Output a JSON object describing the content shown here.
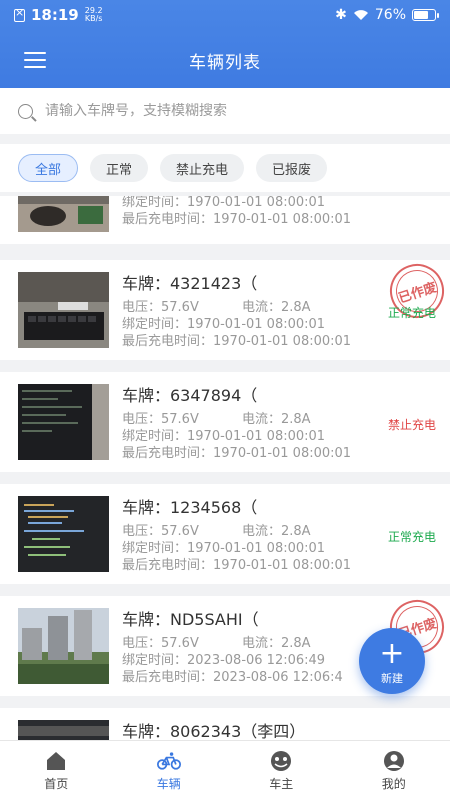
{
  "status": {
    "time": "18:19",
    "net_speed": "29.2",
    "net_unit": "KB/s",
    "battery": "76%",
    "battery_level": 0.76
  },
  "header": {
    "title": "车辆列表"
  },
  "search": {
    "placeholder": "请输入车牌号，支持模糊搜索"
  },
  "filters": [
    "全部",
    "正常",
    "禁止充电",
    "已报废"
  ],
  "vehicles": [
    {
      "plate": "",
      "voltage": "",
      "current": "",
      "bind_time": "绑定时间：1970-01-01 08:00:01",
      "last_charge": "最后充电时间：1970-01-01 08:00:01",
      "state": "",
      "stamp": ""
    },
    {
      "plate": "车牌：4321423（",
      "voltage": "电压：57.6V",
      "current": "电流：2.8A",
      "bind_time": "绑定时间：1970-01-01 08:00:01",
      "last_charge": "最后充电时间：1970-01-01 08:00:01",
      "state": "正常充电",
      "stamp": "已作废"
    },
    {
      "plate": "车牌：6347894（",
      "voltage": "电压：57.6V",
      "current": "电流：2.8A",
      "bind_time": "绑定时间：1970-01-01 08:00:01",
      "last_charge": "最后充电时间：1970-01-01 08:00:01",
      "state": "禁止充电",
      "stamp": ""
    },
    {
      "plate": "车牌：1234568（",
      "voltage": "电压：57.6V",
      "current": "电流：2.8A",
      "bind_time": "绑定时间：1970-01-01 08:00:01",
      "last_charge": "最后充电时间：1970-01-01 08:00:01",
      "state": "正常充电",
      "stamp": ""
    },
    {
      "plate": "车牌：ND5SAHI（",
      "voltage": "电压：57.6V",
      "current": "电流：2.8A",
      "bind_time": "绑定时间：2023-08-06 12:06:49",
      "last_charge": "最后充电时间：2023-08-06 12:06:4",
      "state": "",
      "stamp": "已作废"
    },
    {
      "plate": "车牌：8062343（李四）",
      "voltage": "",
      "current": "",
      "bind_time": "",
      "last_charge": "",
      "state": "",
      "stamp": ""
    }
  ],
  "fab": {
    "label": "新建"
  },
  "tabs": [
    "首页",
    "车辆",
    "车主",
    "我的"
  ],
  "colors": {
    "primary": "#3e7be2",
    "normal": "#1eaa4f",
    "forbidden": "#e04646",
    "stamp": "#d84848"
  }
}
